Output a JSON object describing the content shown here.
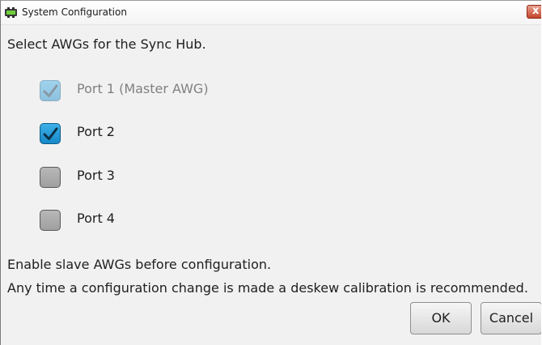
{
  "window": {
    "title": "System Configuration",
    "close_label": "x"
  },
  "instruction": "Select AWGs for the Sync Hub.",
  "ports": [
    {
      "label": "Port 1 (Master AWG)",
      "checked": true,
      "disabled": true
    },
    {
      "label": "Port 2",
      "checked": true,
      "disabled": false
    },
    {
      "label": "Port 3",
      "checked": false,
      "disabled": false
    },
    {
      "label": "Port 4",
      "checked": false,
      "disabled": false
    }
  ],
  "notes": {
    "enable": "Enable slave AWGs before configuration.",
    "deskew": "Any time a configuration change is made a deskew calibration is recommended."
  },
  "buttons": {
    "ok": "OK",
    "cancel": "Cancel"
  },
  "colors": {
    "checkbox_checked": "#1d92d0",
    "checkbox_unchecked": "#a8a8a8",
    "close_button": "#c4462b"
  }
}
